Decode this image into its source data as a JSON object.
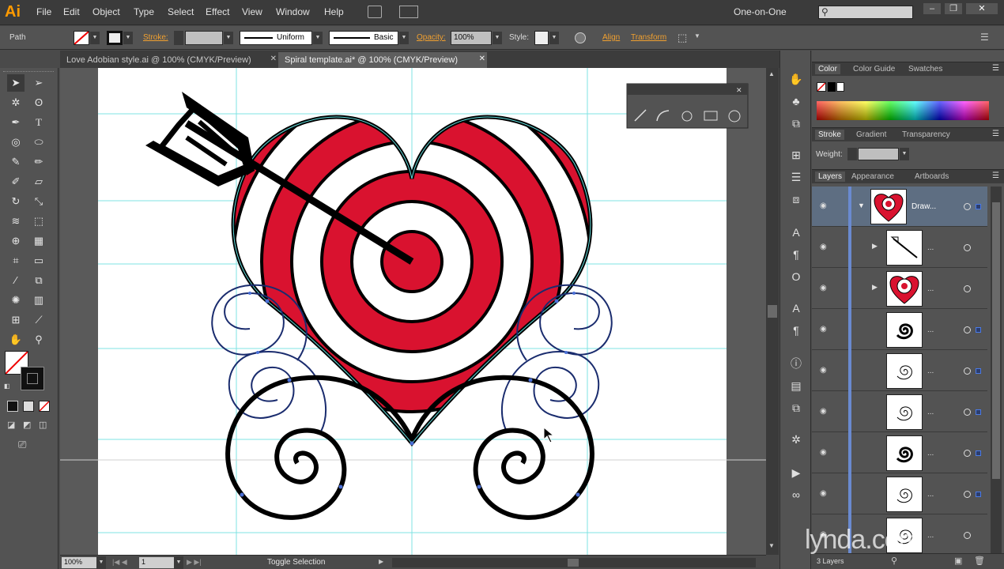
{
  "app": {
    "logo": "Ai",
    "workspace": "One-on-One"
  },
  "menu": [
    "File",
    "Edit",
    "Object",
    "Type",
    "Select",
    "Effect",
    "View",
    "Window",
    "Help"
  ],
  "control": {
    "selection": "Path",
    "stroke_label": "Stroke:",
    "stroke_profile": "Uniform",
    "brush": "Basic",
    "opacity_label": "Opacity:",
    "opacity_value": "100%",
    "style_label": "Style:",
    "align_label": "Align",
    "transform_label": "Transform"
  },
  "tabs": [
    {
      "label": "Love Adobian style.ai @ 100% (CMYK/Preview)",
      "close": "✕"
    },
    {
      "label": "Spiral template.ai* @ 100% (CMYK/Preview)",
      "close": "✕"
    }
  ],
  "status": {
    "zoom": "100%",
    "artboard": "1",
    "message": "Toggle Selection"
  },
  "panels": {
    "color_tabs": [
      "Color",
      "Color Guide",
      "Swatches"
    ],
    "stroke_tabs": [
      "Stroke",
      "Gradient",
      "Transparency"
    ],
    "weight_label": "Weight:",
    "layers_tabs": [
      "Layers",
      "Appearance",
      "Artboards"
    ],
    "layer_name": "Draw...",
    "ellipsis": "...",
    "layers_count": "3 Layers"
  },
  "watermark": "lynda.com",
  "colors": {
    "accent": "#d9122f",
    "guide": "#5fdada",
    "selection_blue": "#4a6fd6",
    "ui_dark": "#535353"
  }
}
